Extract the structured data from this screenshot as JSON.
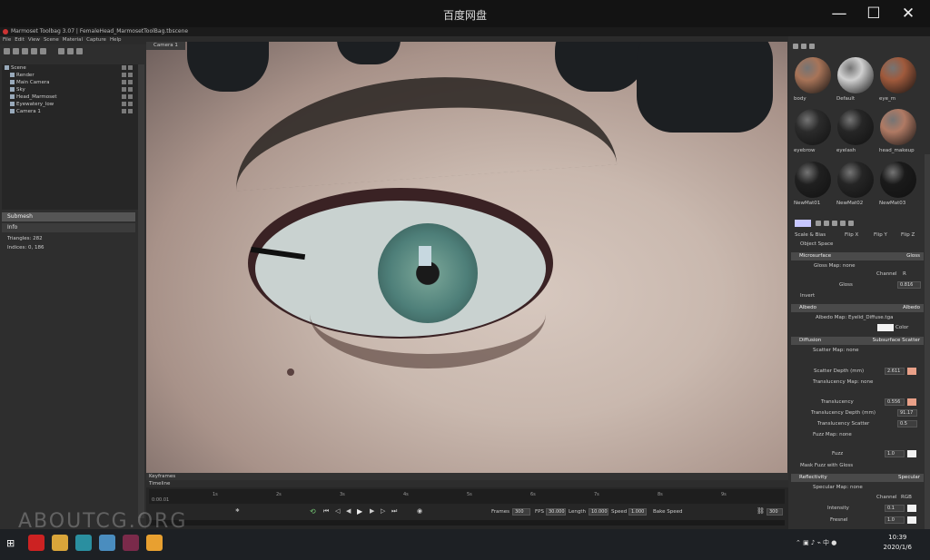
{
  "outer_window": {
    "title": "百度网盘",
    "min_label": "—",
    "max_label": "☐",
    "close_label": "✕"
  },
  "app": {
    "title": "Marmoset Toolbag 3.07  |  FemaleHead_MarmosetToolBag.tbscene",
    "menu": [
      "File",
      "Edit",
      "View",
      "Scene",
      "Material",
      "Capture",
      "Help"
    ],
    "viewport_tab": "Camera 1",
    "scene_tree": [
      "Scene",
      "Render",
      "Main Camera",
      "Sky",
      "Head_Marmoset",
      "Eyewatery_low",
      "Camera 1"
    ],
    "submesh_label": "Submesh",
    "info_label": "Info",
    "triangles": "Triangles: 282",
    "indices": "Indices: 0, 186"
  },
  "materials": [
    {
      "name": "body",
      "color": "#a87458"
    },
    {
      "name": "Default",
      "color": "#d0d0d0"
    },
    {
      "name": "eye_m",
      "color": "#a05a3c"
    },
    {
      "name": "eyebrow",
      "color": "#2b2b2b"
    },
    {
      "name": "eyelash",
      "color": "#262626"
    },
    {
      "name": "head_makeup",
      "color": "#b07a64"
    },
    {
      "name": "NewMat01",
      "color": "#202020"
    },
    {
      "name": "NewMat02",
      "color": "#252525"
    },
    {
      "name": "NewMat03",
      "color": "#1a1a1a"
    }
  ],
  "props": {
    "scale_bias": "Scale & Bias",
    "flip_x": "Flip X",
    "flip_y": "Flip Y",
    "flip_z": "Flip Z",
    "object_space": "Object Space",
    "microsurface": {
      "title": "Microsurface",
      "right": "Gloss",
      "map": "Gloss Map: none",
      "channel": "Channel",
      "channel_val": "R",
      "gloss_label": "Gloss",
      "gloss_val": "0.816",
      "invert": "Invert"
    },
    "albedo": {
      "title": "Albedo",
      "right": "Albedo",
      "map": "Albedo Map: Eyelid_Diffuse.tga",
      "color_label": "Color"
    },
    "diffusion": {
      "title": "Diffusion",
      "right": "Subsurface Scatter",
      "scatter_map": "Scatter Map: none",
      "scatter_depth": "Scatter Depth (mm)",
      "scatter_depth_val": "2.611",
      "transl_map": "Translucency Map: none",
      "transl": "Translucency",
      "transl_val": "0.556",
      "transl_depth": "Translucency Depth (mm)",
      "transl_depth_val": "91.17",
      "transl_scatter": "Translucency Scatter",
      "transl_scatter_val": "0.5",
      "fuzz_map": "Fuzz Map: none",
      "fuzz": "Fuzz",
      "fuzz_val": "1.0",
      "mask_fuzz": "Mask Fuzz with Gloss"
    },
    "reflectivity": {
      "title": "Reflectivity",
      "right": "Specular",
      "map": "Specular Map: none",
      "channel": "Channel",
      "channel_val": "RGB",
      "intensity": "Intensity",
      "intensity_val": "0.1",
      "fresnel": "Fresnel",
      "fresnel_val": "1.0"
    }
  },
  "timeline": {
    "keyframes": "Keyframes",
    "timeline": "Timeline",
    "start": "0:00.01",
    "ticks": [
      "1s",
      "2s",
      "3s",
      "4s",
      "5s",
      "6s",
      "7s",
      "8s",
      "9s"
    ],
    "frames_label": "Frames",
    "frames_val": "300",
    "fps_label": "FPS",
    "fps_val": "30.000",
    "length_label": "Length",
    "length_val": "10.000",
    "speed_label": "Speed",
    "speed_val": "1.000",
    "bake_speed": "Bake Speed",
    "end_val": "300"
  },
  "watermark": "ABOUTCG.ORG",
  "clock": {
    "time": "10:39",
    "date": "2020/1/6"
  },
  "colors": {
    "accent_swatch": "#e9a088",
    "albedo_swatch": "#f2f2f2",
    "selector": "#c7c7ff"
  }
}
